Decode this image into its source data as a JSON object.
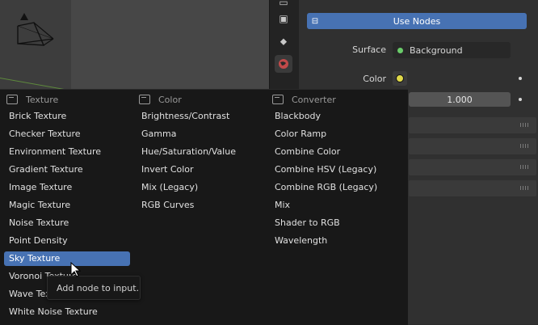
{
  "properties": {
    "use_nodes_label": "Use Nodes",
    "surface_label": "Surface",
    "surface_value": "Background",
    "surface_dot_color": "#6acc6a",
    "color_label": "Color",
    "color_socket_color": "#e0d94a",
    "strength_value": "1.000",
    "accent_color": "#4772b3",
    "tabs": [
      "render-layers-icon",
      "scene-icon",
      "world-icon"
    ]
  },
  "menu": {
    "columns": [
      {
        "header": "Texture",
        "items": [
          "Brick Texture",
          "Checker Texture",
          "Environment Texture",
          "Gradient Texture",
          "Image Texture",
          "Magic Texture",
          "Noise Texture",
          "Point Density",
          "Sky Texture",
          "Voronoi Texture",
          "Wave Texture",
          "White Noise Texture"
        ]
      },
      {
        "header": "Color",
        "items": [
          "Brightness/Contrast",
          "Gamma",
          "Hue/Saturation/Value",
          "Invert Color",
          "Mix (Legacy)",
          "RGB Curves"
        ]
      },
      {
        "header": "Converter",
        "items": [
          "Blackbody",
          "Color Ramp",
          "Combine Color",
          "Combine HSV (Legacy)",
          "Combine RGB (Legacy)",
          "Mix",
          "Shader to RGB",
          "Wavelength"
        ]
      }
    ],
    "selected_item": "Sky Texture"
  },
  "tooltip": {
    "text": "Add node to input."
  }
}
